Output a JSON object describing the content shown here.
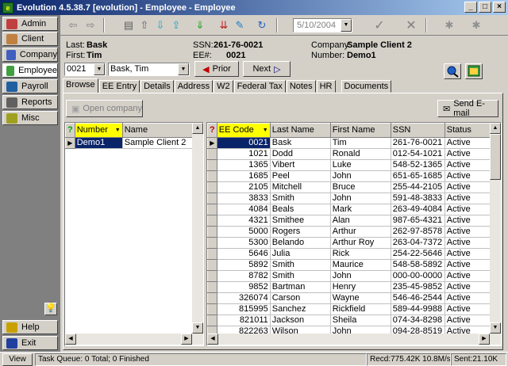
{
  "window": {
    "title": "Evolution 4.5.38.7 [evolution] - Employee - Employee",
    "controls": [
      "_",
      "□",
      "×"
    ]
  },
  "sidebar": {
    "items": [
      {
        "label": "Admin",
        "color": "#c04040"
      },
      {
        "label": "Client",
        "color": "#c08040"
      },
      {
        "label": "Company",
        "color": "#4060c0"
      },
      {
        "label": "Employee",
        "color": "#40a040"
      },
      {
        "label": "Payroll",
        "color": "#2060a0"
      },
      {
        "label": "Reports",
        "color": "#606060"
      },
      {
        "label": "Misc",
        "color": "#a0a020"
      }
    ],
    "help": "Help",
    "exit": "Exit",
    "bulb": "💡"
  },
  "toolbar": {
    "icons": [
      "⇦",
      "⇨",
      "▤",
      "⇧",
      "⇩",
      "⇪",
      "⇓",
      "⇊",
      "✎",
      "↻",
      "✓",
      "✕",
      "✱",
      "✱"
    ],
    "date_value": "5/10/2004"
  },
  "employee_info": {
    "last_label": "Last:",
    "last_value": "Bask",
    "first_label": "First:",
    "first_value": "Tim",
    "ssn_label": "SSN:",
    "ssn_value": "261-76-0021",
    "ee_label": "EE#:",
    "ee_value": "0021",
    "company_label": "Company:",
    "company_value": "Sample Client 2",
    "number_label": "Number:",
    "number_value": "Demo1"
  },
  "lookup": {
    "ee_code": "0021",
    "name": "Bask, Tim",
    "prior": "Prior",
    "next": "Next"
  },
  "tabs": [
    "Browse",
    "EE Entry",
    "Details",
    "Address",
    "W2",
    "Federal Tax",
    "Notes",
    "HR",
    "Documents"
  ],
  "buttons": {
    "open_company": "Open company",
    "send_email": "Send E-mail"
  },
  "company_grid": {
    "columns": [
      "Number",
      "Name"
    ],
    "rows": [
      [
        "Demo1",
        "Sample Client 2"
      ]
    ]
  },
  "employee_grid": {
    "columns": [
      "EE Code",
      "Last Name",
      "First Name",
      "SSN",
      "Status"
    ],
    "rows": [
      [
        "0021",
        "Bask",
        "Tim",
        "261-76-0021",
        "Active"
      ],
      [
        "1021",
        "Dodd",
        "Ronald",
        "012-54-1021",
        "Active"
      ],
      [
        "1365",
        "Vibert",
        "Luke",
        "548-52-1365",
        "Active"
      ],
      [
        "1685",
        "Peel",
        "John",
        "651-65-1685",
        "Active"
      ],
      [
        "2105",
        "Mitchell",
        "Bruce",
        "255-44-2105",
        "Active"
      ],
      [
        "3833",
        "Smith",
        "John",
        "591-48-3833",
        "Active"
      ],
      [
        "4084",
        "Beals",
        "Mark",
        "263-49-4084",
        "Active"
      ],
      [
        "4321",
        "Smithee",
        "Alan",
        "987-65-4321",
        "Active"
      ],
      [
        "5000",
        "Rogers",
        "Arthur",
        "262-97-8578",
        "Active"
      ],
      [
        "5300",
        "Belando",
        "Arthur Roy",
        "263-04-7372",
        "Active"
      ],
      [
        "5646",
        "Julia",
        "Rick",
        "254-22-5646",
        "Active"
      ],
      [
        "5892",
        "Smith",
        "Maurice",
        "548-58-5892",
        "Active"
      ],
      [
        "8782",
        "Smith",
        "John",
        "000-00-0000",
        "Active"
      ],
      [
        "9852",
        "Bartman",
        "Henry",
        "235-45-9852",
        "Active"
      ],
      [
        "326074",
        "Carson",
        "Wayne",
        "546-46-2544",
        "Active"
      ],
      [
        "815995",
        "Sanchez",
        "Rickfield",
        "589-44-9988",
        "Active"
      ],
      [
        "821011",
        "Jackson",
        "Sheila",
        "074-34-8298",
        "Active"
      ],
      [
        "822263",
        "Wilson",
        "John",
        "094-28-8519",
        "Active"
      ]
    ]
  },
  "statusbar": {
    "view": "View",
    "queue": "Task Queue: 0 Total; 0 Finished",
    "recd": "Recd:775.42K 10.8M/sec",
    "sent": "Sent:21.10K"
  }
}
